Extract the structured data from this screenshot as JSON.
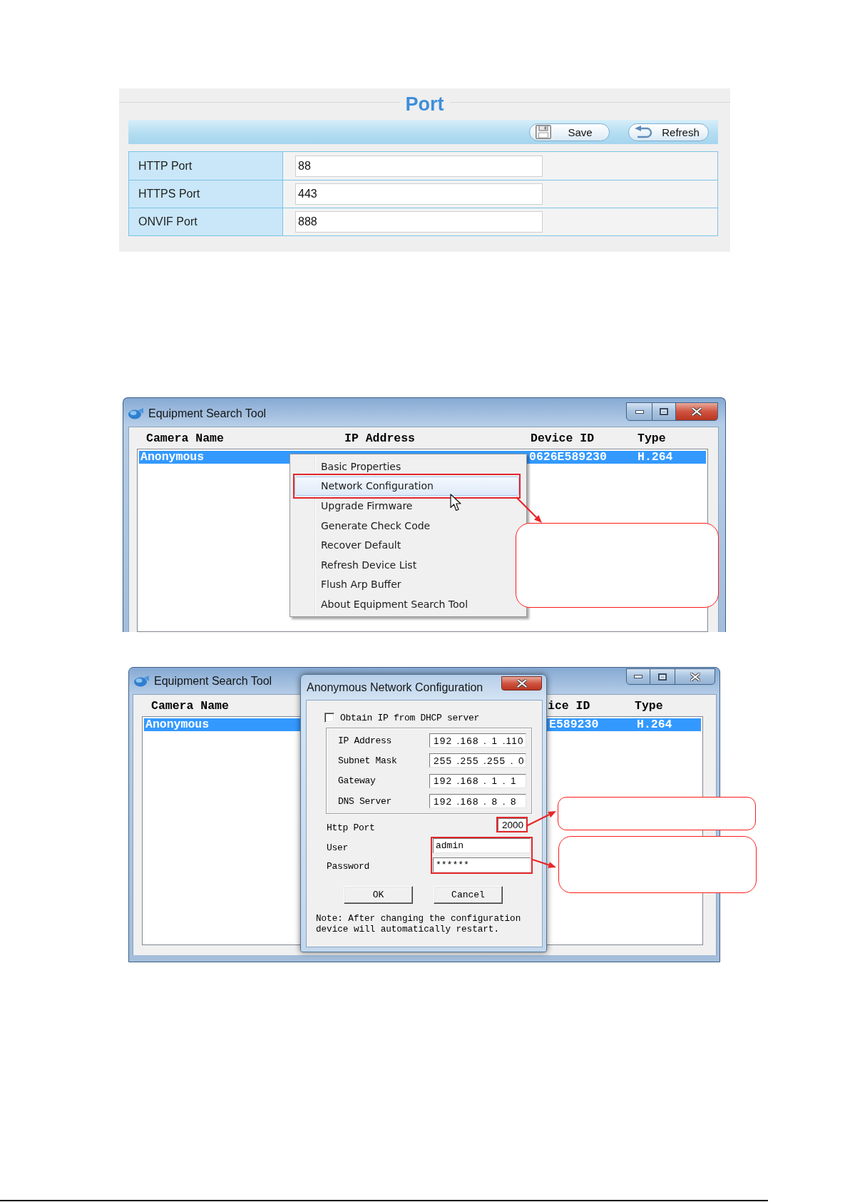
{
  "port_settings": {
    "title": "Port",
    "buttons": [
      {
        "kind": "save",
        "label": "Save"
      },
      {
        "kind": "refresh",
        "label": "Refresh"
      }
    ],
    "fields": [
      {
        "label": "HTTP Port",
        "value": "88"
      },
      {
        "label": "HTTPS Port",
        "value": "443"
      },
      {
        "label": "ONVIF Port",
        "value": "888"
      }
    ]
  },
  "search_tool_menu": {
    "window": {
      "title": "Equipment Search Tool",
      "active": true
    },
    "columns": [
      "Camera Name",
      "IP Address",
      "Device ID",
      "Type"
    ],
    "rows": [
      {
        "camera_name": "Anonymous",
        "device_id": "0626E589230",
        "type": "H.264",
        "selected": true
      }
    ],
    "context_menu": {
      "items": [
        {
          "label": "Basic Properties",
          "selected": false
        },
        {
          "label": "Network Configuration",
          "selected": true
        },
        {
          "label": "Upgrade Firmware",
          "selected": false
        },
        {
          "label": "Generate Check Code",
          "selected": false
        },
        {
          "label": "Recover Default",
          "selected": false
        },
        {
          "label": "Refresh Device List",
          "selected": false
        },
        {
          "label": "Flush Arp Buffer",
          "selected": false
        },
        {
          "label": "About Equipment Search Tool",
          "selected": false
        }
      ]
    }
  },
  "search_tool_dialog": {
    "window": {
      "title": "Equipment Search Tool",
      "active": false
    },
    "columns": [
      "Camera Name",
      "ice ID",
      "Type"
    ],
    "rows": [
      {
        "camera_name": "Anonymous",
        "device_id": "E589230",
        "type": "H.264",
        "selected": true
      }
    ],
    "dialog": {
      "title": "Anonymous Network Configuration",
      "dhcp": {
        "label": "Obtain IP from DHCP server",
        "checked": false
      },
      "addresses": [
        {
          "label": "IP Address",
          "value": "192 .168 . 1 .110"
        },
        {
          "label": "Subnet Mask",
          "value": "255 .255 .255 . 0"
        },
        {
          "label": "Gateway",
          "value": "192 .168 . 1 . 1"
        },
        {
          "label": "DNS Server",
          "value": "192 .168 . 8 . 8"
        }
      ],
      "http_port": {
        "label": "Http Port",
        "value": "2000"
      },
      "user": {
        "label": "User",
        "value": "admin"
      },
      "password": {
        "label": "Password",
        "value": "******"
      },
      "buttons": [
        "OK",
        "Cancel"
      ],
      "note": [
        "Note: After changing the configuration",
        "device will automatically restart."
      ]
    }
  }
}
